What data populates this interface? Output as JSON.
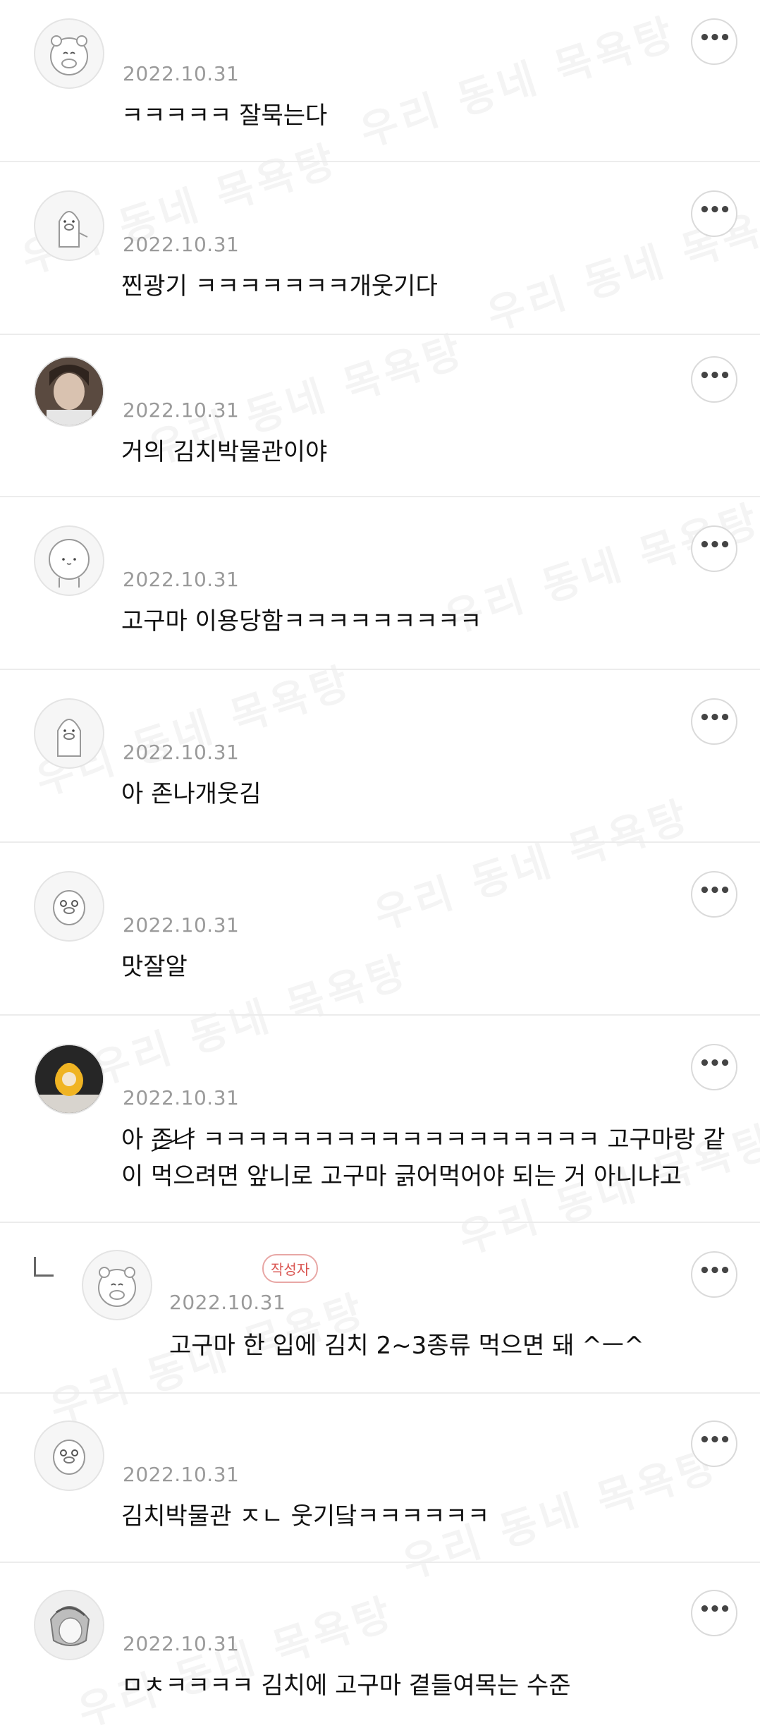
{
  "watermark_text": "우리 동네 목욕탕",
  "author_badge": "작성자",
  "more_label": "•••",
  "comments": [
    {
      "date": "2022.10.31",
      "lines": [
        "ㅋㅋㅋㅋㅋ 잘묵는다"
      ]
    },
    {
      "date": "2022.10.31",
      "lines": [
        "찐광기 ㅋㅋㅋㅋㅋㅋㅋ개웃기다"
      ]
    },
    {
      "date": "2022.10.31",
      "lines": [
        "거의 김치박물관이야"
      ]
    },
    {
      "date": "2022.10.31",
      "lines": [
        "고구마 이용당함ㅋㅋㅋㅋㅋㅋㅋㅋㅋ"
      ]
    },
    {
      "date": "2022.10.31",
      "lines": [
        "아 존나개웃김"
      ]
    },
    {
      "date": "2022.10.31",
      "lines": [
        "맛잘알"
      ]
    },
    {
      "date": "2022.10.31",
      "prefix": "아 ",
      "struck": "존나",
      "lines": [
        "ㅋㅋㅋㅋㅋㅋㅋㅋㅋㅋㅋㅋㅋㅋㅋㅋㅋㅋ 고구마랑 같",
        "이 먹으려면 앞니로 고구마 긁어먹어야 되는 거 아니냐고"
      ]
    },
    {
      "date": "2022.10.31",
      "reply": true,
      "lines": [
        "고구마 한 입에 김치 2~3종류 먹으면 돼 ^ㅡ^"
      ]
    },
    {
      "date": "2022.10.31",
      "lines": [
        "김치박물관 ㅈㄴ 웃기닼ㅋㅋㅋㅋㅋㅋ"
      ]
    },
    {
      "date": "2022.10.31",
      "lines": [
        "ㅁㅊㅋㅋㅋㅋ 김치에 고구마 곁들여목는 수준"
      ]
    }
  ]
}
